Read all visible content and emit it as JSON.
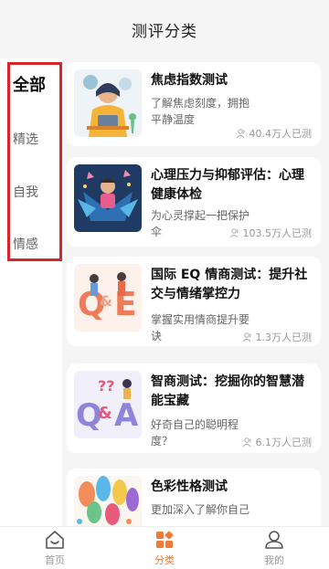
{
  "header": {
    "title": "测评分类"
  },
  "sidebar": {
    "items": [
      {
        "label": "全部",
        "active": true
      },
      {
        "label": "精选",
        "active": false
      },
      {
        "label": "自我",
        "active": false
      },
      {
        "label": "情感",
        "active": false
      }
    ]
  },
  "cards": [
    {
      "title": "焦虑指数测试",
      "desc": "了解焦虑刻度，拥抱平静温度",
      "count": "40.4万人已测",
      "thumb": "anxiety-illustration"
    },
    {
      "title": "心理压力与抑郁评估：心理健康体检",
      "desc": "为心灵撑起一把保护伞",
      "count": "103.5万人已测",
      "thumb": "stress-illustration"
    },
    {
      "title": "国际 EQ 情商测试：提升社交与情绪掌控力",
      "desc": "掌握实用情商提升要诀",
      "count": "1.3万人已测",
      "thumb": "q-and-e-illustration"
    },
    {
      "title": "智商测试：挖掘你的智慧潜能宝藏",
      "desc": "好奇自己的聪明程度？",
      "count": "6.1万人已测",
      "thumb": "q-and-a-illustration"
    },
    {
      "title": "色彩性格测试",
      "desc": "更加深入了解你自己",
      "count": "",
      "thumb": "color-hands-illustration"
    }
  ],
  "tabbar": {
    "items": [
      {
        "label": "首页",
        "icon": "home-icon",
        "active": false
      },
      {
        "label": "分类",
        "icon": "category-icon",
        "active": true
      },
      {
        "label": "我的",
        "icon": "profile-icon",
        "active": false
      }
    ]
  },
  "colors": {
    "accent": "#f07a36",
    "highlight": "#d6262a"
  }
}
